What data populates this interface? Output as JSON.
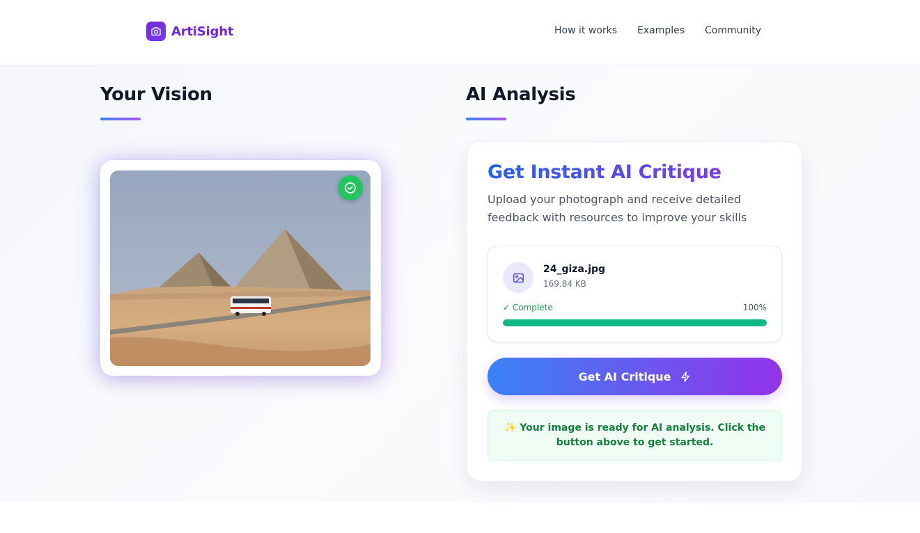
{
  "app": {
    "name": "ArtiSight"
  },
  "nav": {
    "items": [
      "How it works",
      "Examples",
      "Community"
    ]
  },
  "left_section": {
    "title": "Your Vision"
  },
  "right_section": {
    "title": "AI Analysis"
  },
  "analysis_card": {
    "title": "Get Instant AI Critique",
    "subtitle": "Upload your photograph and receive detailed feedback with resources to improve your skills"
  },
  "upload": {
    "file_name": "24_giza.jpg",
    "file_size": "169.84 KB",
    "status": "✓ Complete",
    "percent_label": "100%",
    "progress": 1.0
  },
  "actions": {
    "critique_button": "Get AI Critique"
  },
  "ready_message": "✨ Your image is ready for AI analysis. Click the button above to get started.",
  "colors": {
    "brand": "#6d28d9",
    "accent_gradient_start": "#3b82f6",
    "accent_gradient_end": "#9333ea",
    "success": "#22c55e",
    "progress": "#10b981"
  },
  "icons": {
    "logo": "camera-icon",
    "photo_status": "check-circle-icon",
    "file": "image-icon",
    "button": "lightning-icon"
  }
}
